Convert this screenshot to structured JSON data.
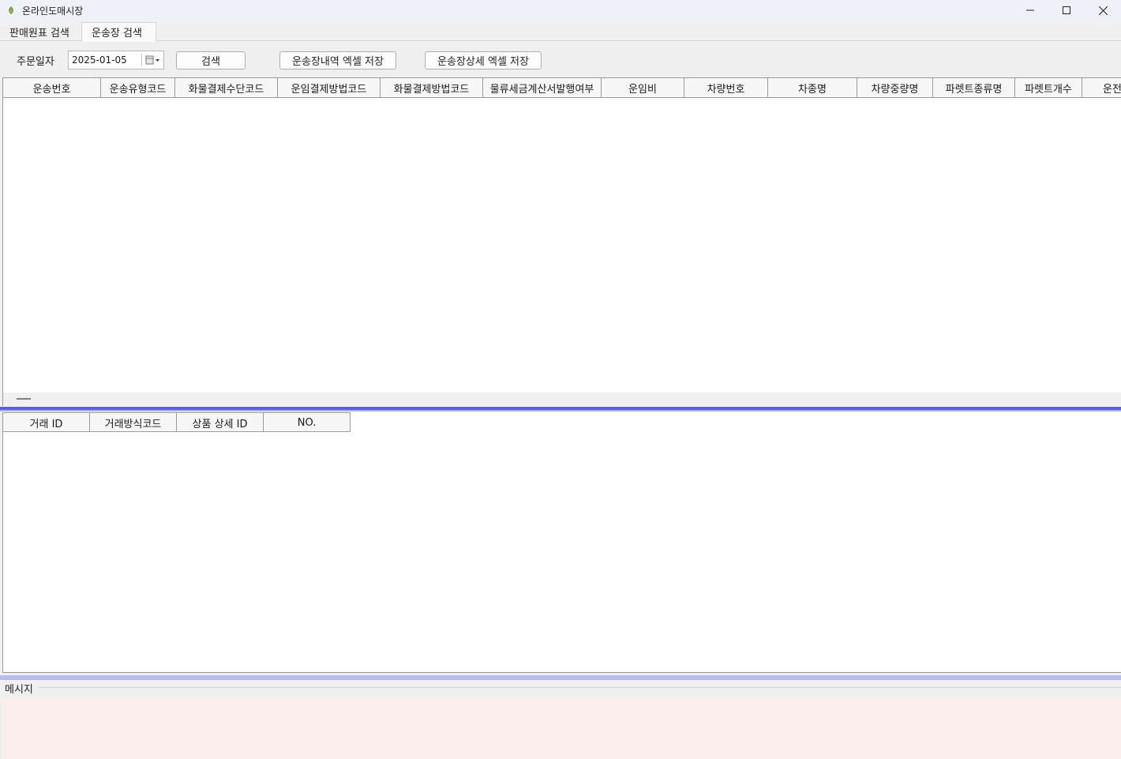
{
  "window": {
    "title": "온라인도매시장"
  },
  "tabs": [
    {
      "label": "판매원표 검색",
      "active": false
    },
    {
      "label": "운송장 검색",
      "active": true
    }
  ],
  "toolbar": {
    "date_label": "주문일자",
    "date_value": "2025-01-05",
    "search_label": "검색",
    "export_list_label": "운송장내역 엑셀 저장",
    "export_detail_label": "운송장상세 엑셀 저장"
  },
  "waybill_grid": {
    "columns": [
      "운송번호",
      "운송유형코드",
      "화물결제수단코드",
      "운임결제방법코드",
      "화물결제방법코드",
      "물류세금계산서발행여부",
      "운임비",
      "차량번호",
      "차종명",
      "차량중량명",
      "파렛트종류명",
      "파렛트개수",
      "운전"
    ]
  },
  "detail_grid": {
    "columns": [
      "거래 ID",
      "거래방식코드",
      "상품 상세 ID",
      "NO."
    ]
  },
  "message": {
    "label": "메시지"
  },
  "colors": {
    "splitter": "#5860e6",
    "message_bg": "#fdeeee"
  }
}
